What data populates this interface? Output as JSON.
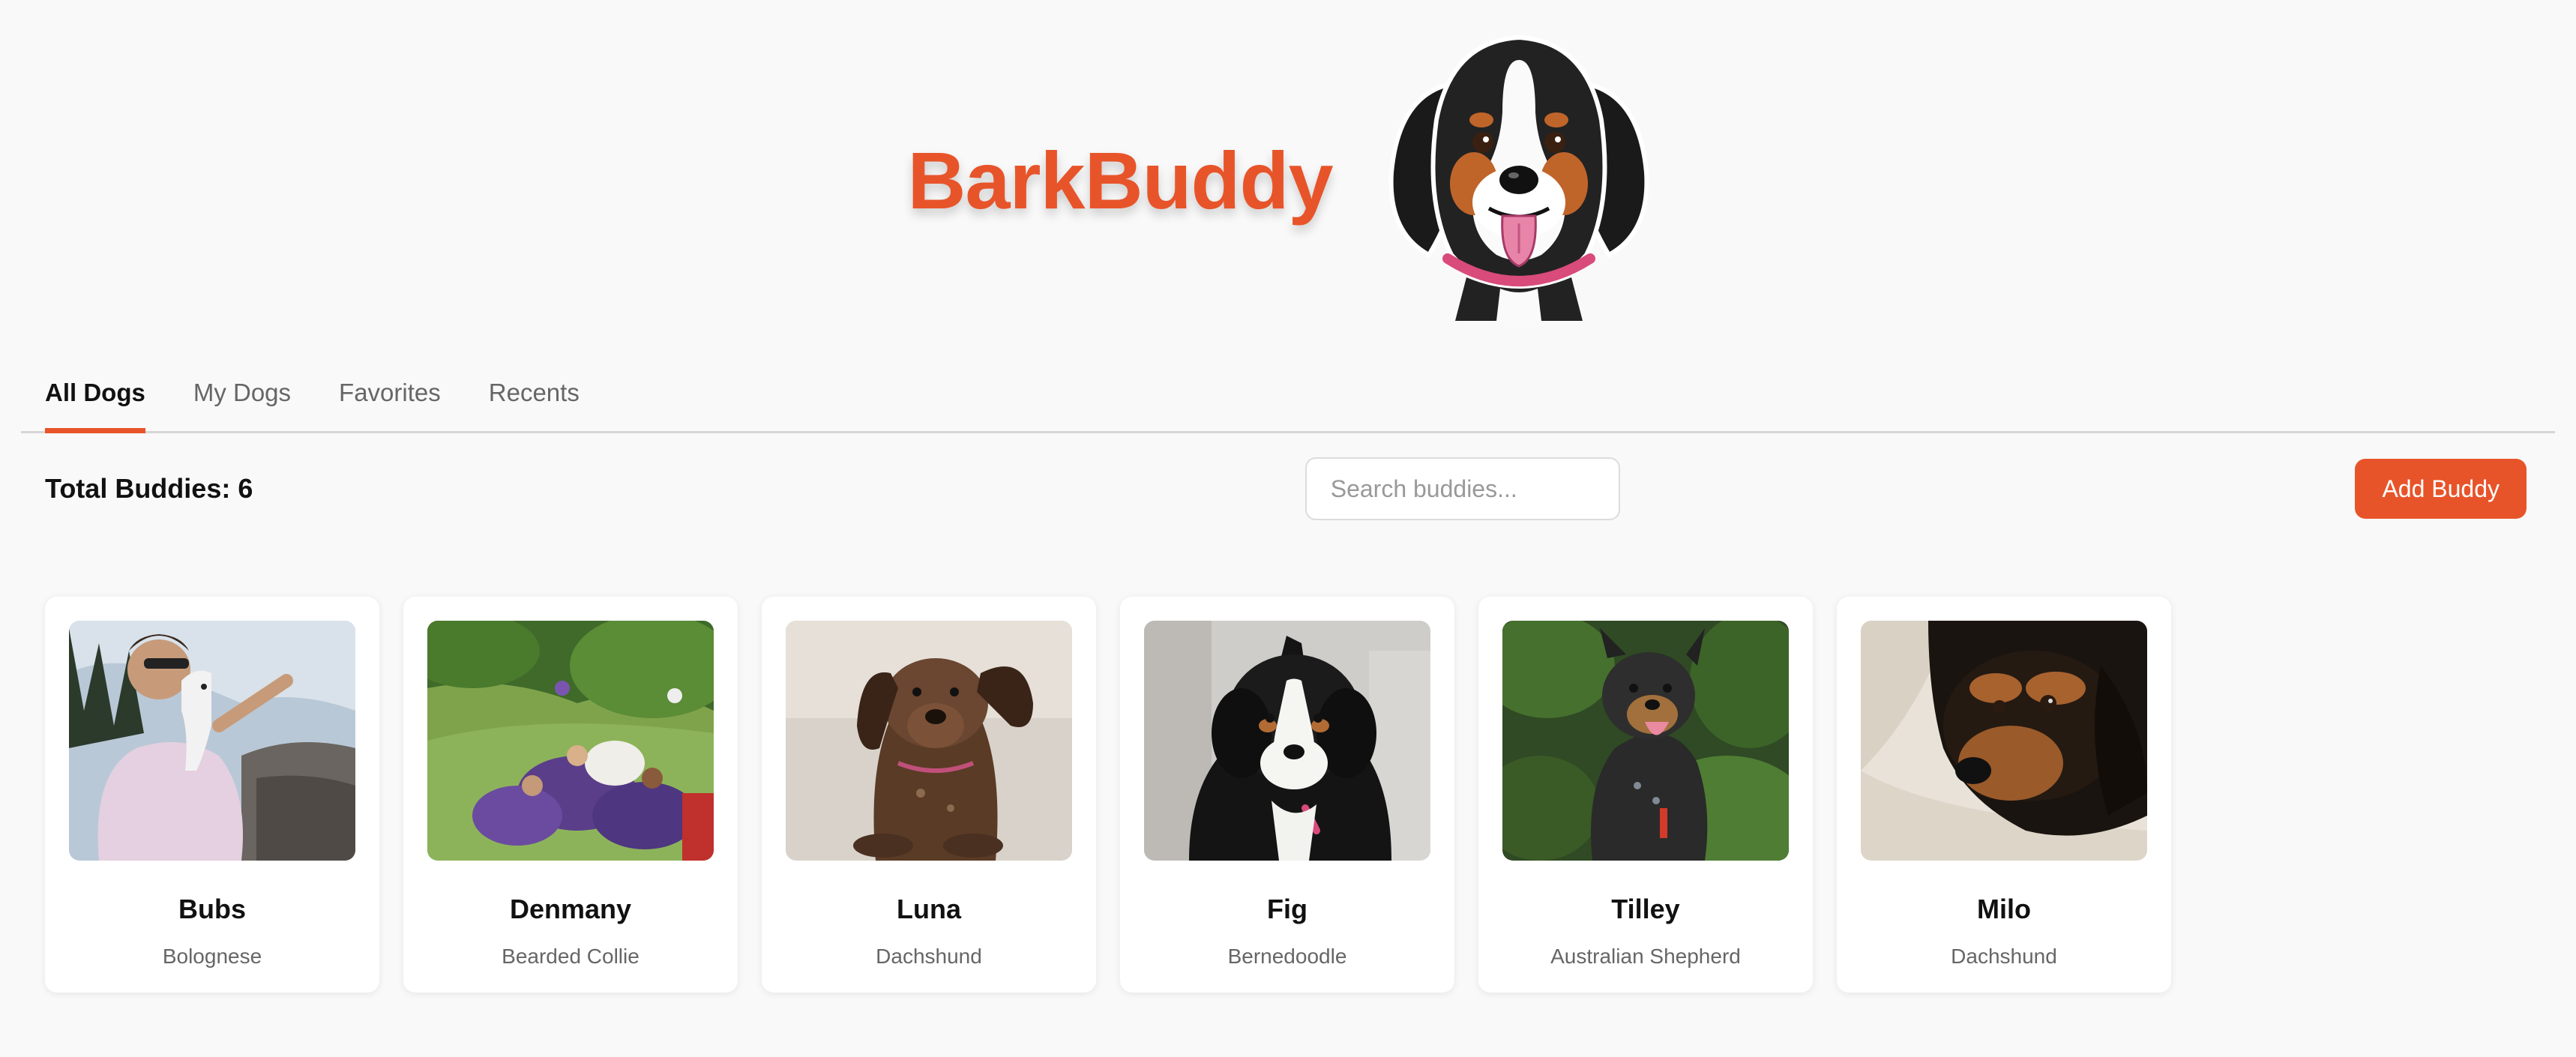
{
  "brand": {
    "title": "BarkBuddy",
    "logo_icon": "bernese-dog-logo"
  },
  "tabs": [
    {
      "label": "All Dogs",
      "active": true
    },
    {
      "label": "My Dogs",
      "active": false
    },
    {
      "label": "Favorites",
      "active": false
    },
    {
      "label": "Recents",
      "active": false
    }
  ],
  "toolbar": {
    "total_label": "Total Buddies: 6",
    "search_placeholder": "Search buddies...",
    "search_value": "",
    "add_button_label": "Add Buddy"
  },
  "dogs": [
    {
      "name": "Bubs",
      "breed": "Bolognese"
    },
    {
      "name": "Denmany",
      "breed": "Bearded Collie"
    },
    {
      "name": "Luna",
      "breed": "Dachshund"
    },
    {
      "name": "Fig",
      "breed": "Bernedoodle"
    },
    {
      "name": "Tilley",
      "breed": "Australian Shepherd"
    },
    {
      "name": "Milo",
      "breed": "Dachshund"
    }
  ],
  "colors": {
    "accent": "#e8542a",
    "background": "#f9f9f9",
    "card": "#ffffff"
  }
}
